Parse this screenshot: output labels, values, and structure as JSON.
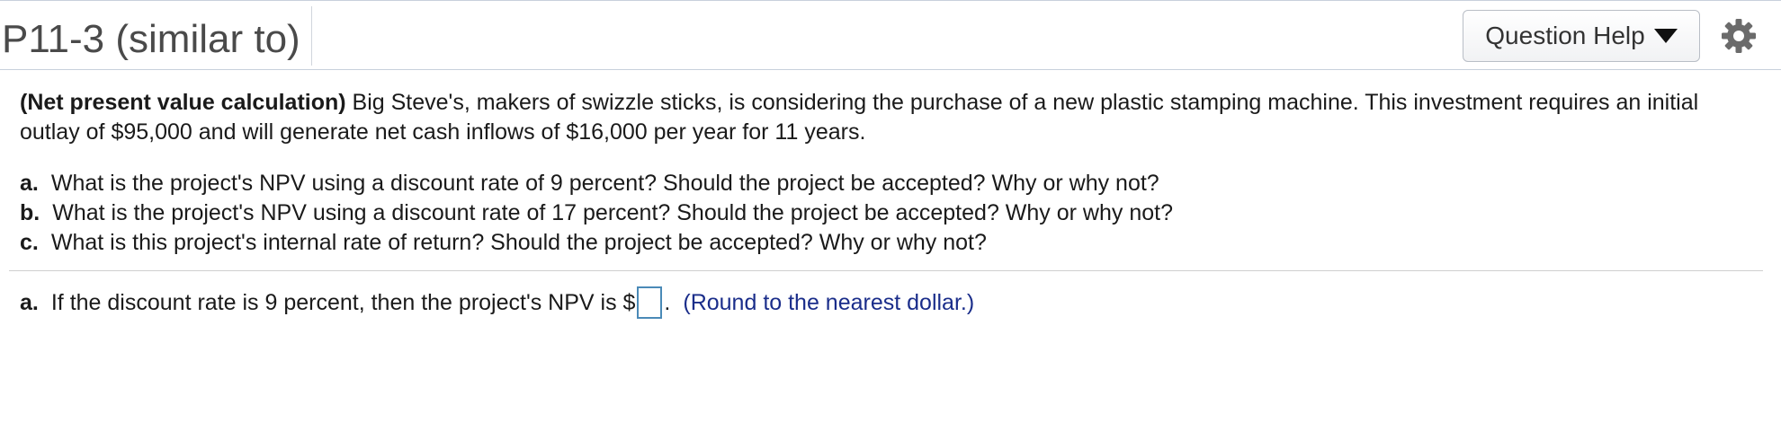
{
  "header": {
    "title": "P11-3 (similar to)",
    "help_button_label": "Question Help",
    "help_caret_icon": "triangle-down-icon",
    "settings_icon": "gear-icon"
  },
  "problem": {
    "bold_lead": "(Net present value calculation)",
    "text": " Big Steve's, makers of swizzle sticks, is considering the purchase of a new plastic stamping machine.  This investment requires an initial outlay of $95,000 and will generate net cash inflows of $16,000 per year for 11 years."
  },
  "parts": [
    {
      "letter": "a.",
      "text": "What is the project's NPV using a discount rate of 9 percent?  Should the project be accepted?  Why or why not?"
    },
    {
      "letter": "b.",
      "text": "What is the project's NPV using a discount rate of 17 percent?  Should the project be accepted?  Why or why not?"
    },
    {
      "letter": "c.",
      "text": "What is this project's internal rate of return?  Should the project be accepted?  Why or why not?"
    }
  ],
  "answer": {
    "letter": "a.",
    "prefix": "If the discount rate is 9 percent, then the project's NPV is $",
    "input_value": "",
    "suffix": ".",
    "hint": "(Round to the nearest dollar.)"
  },
  "colors": {
    "hint": "#1a2d8a",
    "input_border": "#4a8ab7",
    "header_border": "#c8d0dc"
  }
}
